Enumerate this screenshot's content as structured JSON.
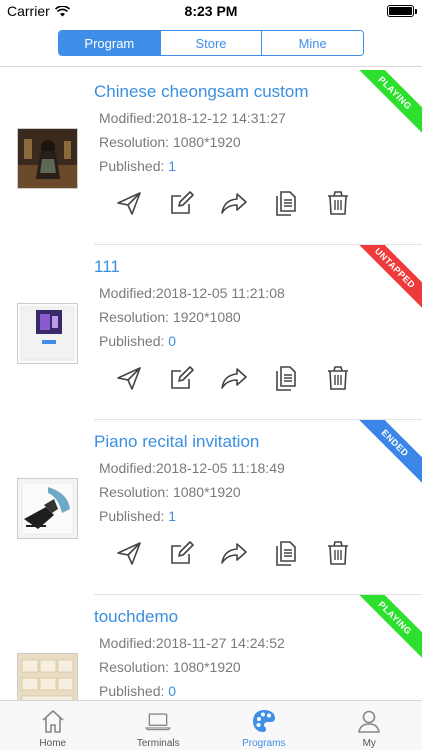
{
  "status_bar": {
    "carrier": "Carrier",
    "time": "8:23 PM"
  },
  "segments": [
    {
      "label": "Program",
      "active": true
    },
    {
      "label": "Store",
      "active": false
    },
    {
      "label": "Mine",
      "active": false
    }
  ],
  "labels": {
    "modified": "Modified:",
    "resolution": "Resolution: ",
    "published": "Published: "
  },
  "programs": [
    {
      "title": "Chinese cheongsam custom",
      "modified": "2018-12-12 14:31:27",
      "resolution": "1080*1920",
      "published": "1",
      "status": "PLAYING",
      "status_color": "#2ee02e"
    },
    {
      "title": "111",
      "modified": "2018-12-05 11:21:08",
      "resolution": "1920*1080",
      "published": "0",
      "status": "UNTAPPED",
      "status_color": "#ee3a3a"
    },
    {
      "title": "Piano recital invitation",
      "modified": "2018-12-05 11:18:49",
      "resolution": "1080*1920",
      "published": "1",
      "status": "ENDED",
      "status_color": "#3b86e6"
    },
    {
      "title": "touchdemo",
      "modified": "2018-11-27 14:24:52",
      "resolution": "1080*1920",
      "published": "0",
      "status": "PLAYING",
      "status_color": "#2ee02e"
    }
  ],
  "tabs": [
    {
      "label": "Home",
      "icon": "home-icon"
    },
    {
      "label": "Terminals",
      "icon": "laptop-icon"
    },
    {
      "label": "Programs",
      "icon": "palette-icon",
      "active": true
    },
    {
      "label": "My",
      "icon": "user-icon"
    }
  ],
  "colors": {
    "accent": "#3f8ee8",
    "playing": "#2ee02e",
    "untapped": "#ee3a3a",
    "ended": "#3b86e6"
  }
}
